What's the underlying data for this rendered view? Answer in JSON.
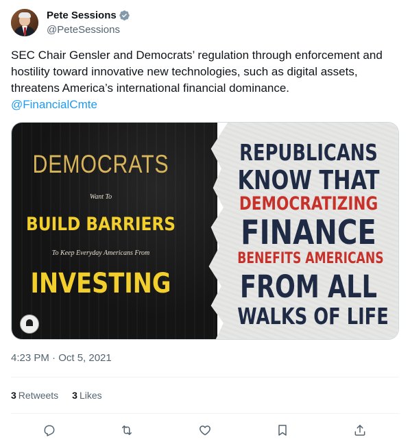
{
  "author": {
    "name": "Pete Sessions",
    "handle": "@PeteSessions",
    "verified": true
  },
  "tweet": {
    "text": "SEC Chair Gensler and Democrats’ regulation through enforcement and hostility toward innovative new technologies, such as digital assets, threatens America’s international financial dominance.",
    "mention": "@FinancialCmte",
    "timestamp": "4:23 PM · Oct 5, 2021"
  },
  "media": {
    "left": {
      "line1": "DEMOCRATS",
      "line2": "Want To",
      "line3": "BUILD BARRIERS",
      "line4": "To Keep Everyday Americans From",
      "line5": "INVESTING"
    },
    "right": {
      "line1": "REPUBLICANS",
      "line2": "KNOW THAT",
      "line3": "DEMOCRATIZING",
      "line4": "FINANCE",
      "line5": "BENEFITS AMERICANS",
      "line6": "FROM ALL",
      "line7": "WALKS OF LIFE"
    }
  },
  "stats": {
    "retweets_count": "3",
    "retweets_label": "Retweets",
    "likes_count": "3",
    "likes_label": "Likes"
  },
  "actions": {
    "icons": [
      "reply-icon",
      "retweet-icon",
      "like-icon",
      "bookmark-icon",
      "share-icon"
    ]
  },
  "colors": {
    "accent": "#1d9bf0",
    "text": "#0f1419",
    "secondary": "#536471",
    "verified": "#829aab"
  }
}
